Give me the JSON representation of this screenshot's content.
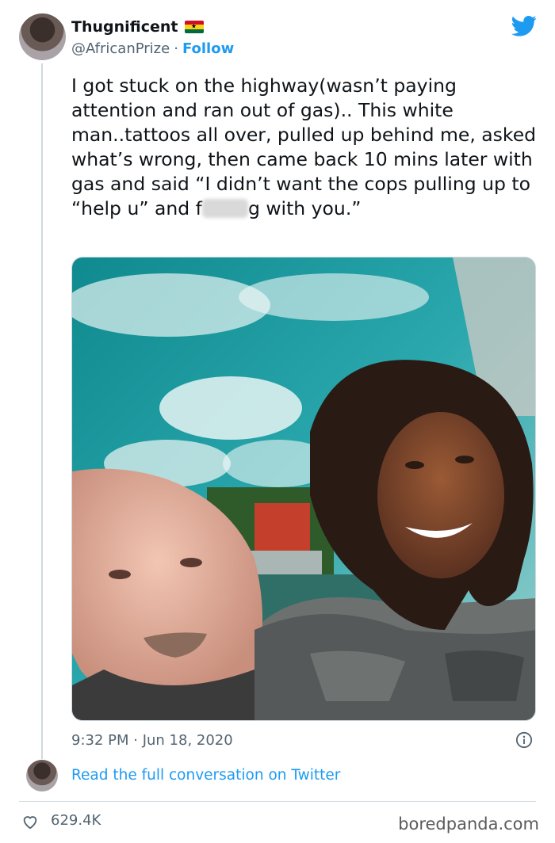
{
  "author": {
    "display_name": "Thugnificent",
    "handle": "@AfricanPrize",
    "separator": "·",
    "follow_label": "Follow"
  },
  "tweet": {
    "text_before": "I got stuck on the highway(wasn’t paying attention and ran out of gas).. This white man..tattoos all over, pulled up behind me, asked what’s wrong, then came back 10 mins later with gas and said “I didn’t want the cops pulling up to “help u” and f",
    "text_after": "g with you.”",
    "timestamp": "9:32 PM · Jun 18, 2020"
  },
  "conversation": {
    "link_label": "Read the full conversation on Twitter"
  },
  "stats": {
    "likes": "629.4K"
  },
  "watermark": "boredpanda.com",
  "icons": {
    "platform": "twitter-bird-icon",
    "flag": "ghana-flag-icon",
    "info": "info-icon",
    "like": "heart-icon"
  },
  "colors": {
    "accent": "#1d9bf0",
    "muted": "#536471",
    "border": "#cfd9de"
  }
}
